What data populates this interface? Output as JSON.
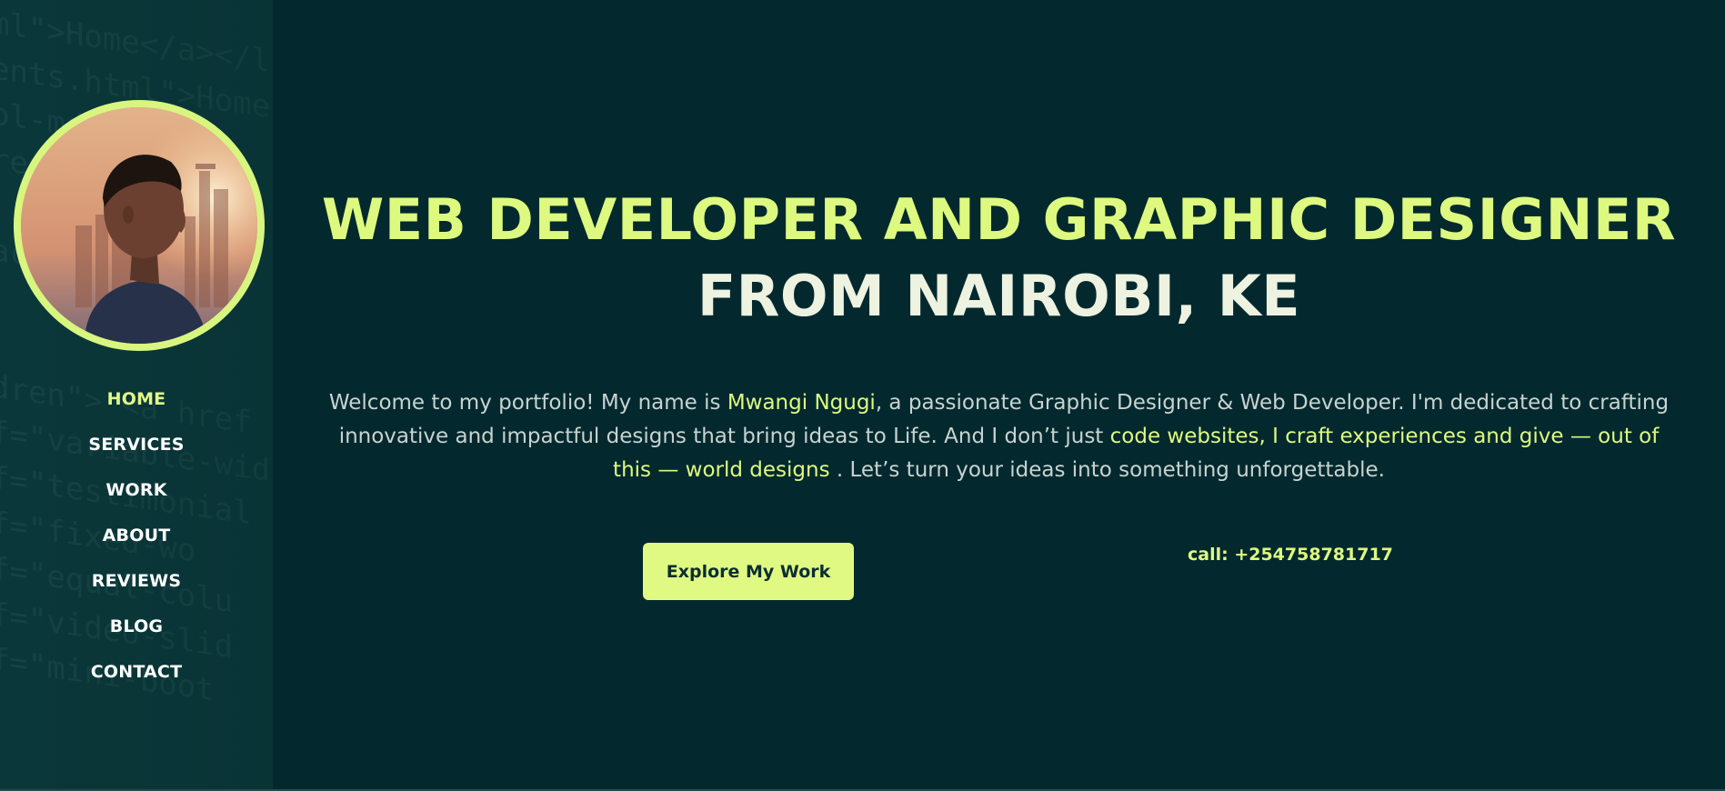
{
  "sidebar": {
    "code_background": [
      "ml\">Home</a></l",
      "ents.html\">Home",
      "ol-md-3\"><a",
      "ren\">\"Mu",
      "  h\"><a",
      "act\">tr",
      "   href",
      "  ",
      "dren\"> <a href",
      "",
      "f=\"variable-wid",
      "f=\"testimonial",
      "f=\"fixed-wo",
      "f=\"equal-colu",
      "f=\"video-slid",
      "f=\"mini-boot"
    ],
    "nav": [
      {
        "label": "HOME",
        "active": true
      },
      {
        "label": "SERVICES",
        "active": false
      },
      {
        "label": "WORK",
        "active": false
      },
      {
        "label": "ABOUT",
        "active": false
      },
      {
        "label": "REVIEWS",
        "active": false
      },
      {
        "label": "BLOG",
        "active": false
      },
      {
        "label": "CONTACT",
        "active": false
      }
    ]
  },
  "hero": {
    "headline_line1": "WEB DEVELOPER AND GRAPHIC DESIGNER",
    "headline_line2": "FROM NAIROBI, KE",
    "intro_part1": "Welcome to my portfolio! My name is ",
    "intro_name": "Mwangi Ngugi",
    "intro_part2": ", a passionate Graphic Designer & Web Developer. I'm dedicated to crafting innovative and impactful designs that bring ideas to Life. And I don’t just ",
    "intro_highlight": "code websites, I craft experiences and give — out of this — world designs",
    "intro_part3": " . Let’s turn your ideas into something unforgettable.",
    "cta_label": "Explore My Work",
    "call_label": "call: +254758781717"
  },
  "colors": {
    "background": "#03292f",
    "sidebar": "#0b3a3c",
    "accent": "#def97f",
    "text": "#c8d3cf"
  }
}
